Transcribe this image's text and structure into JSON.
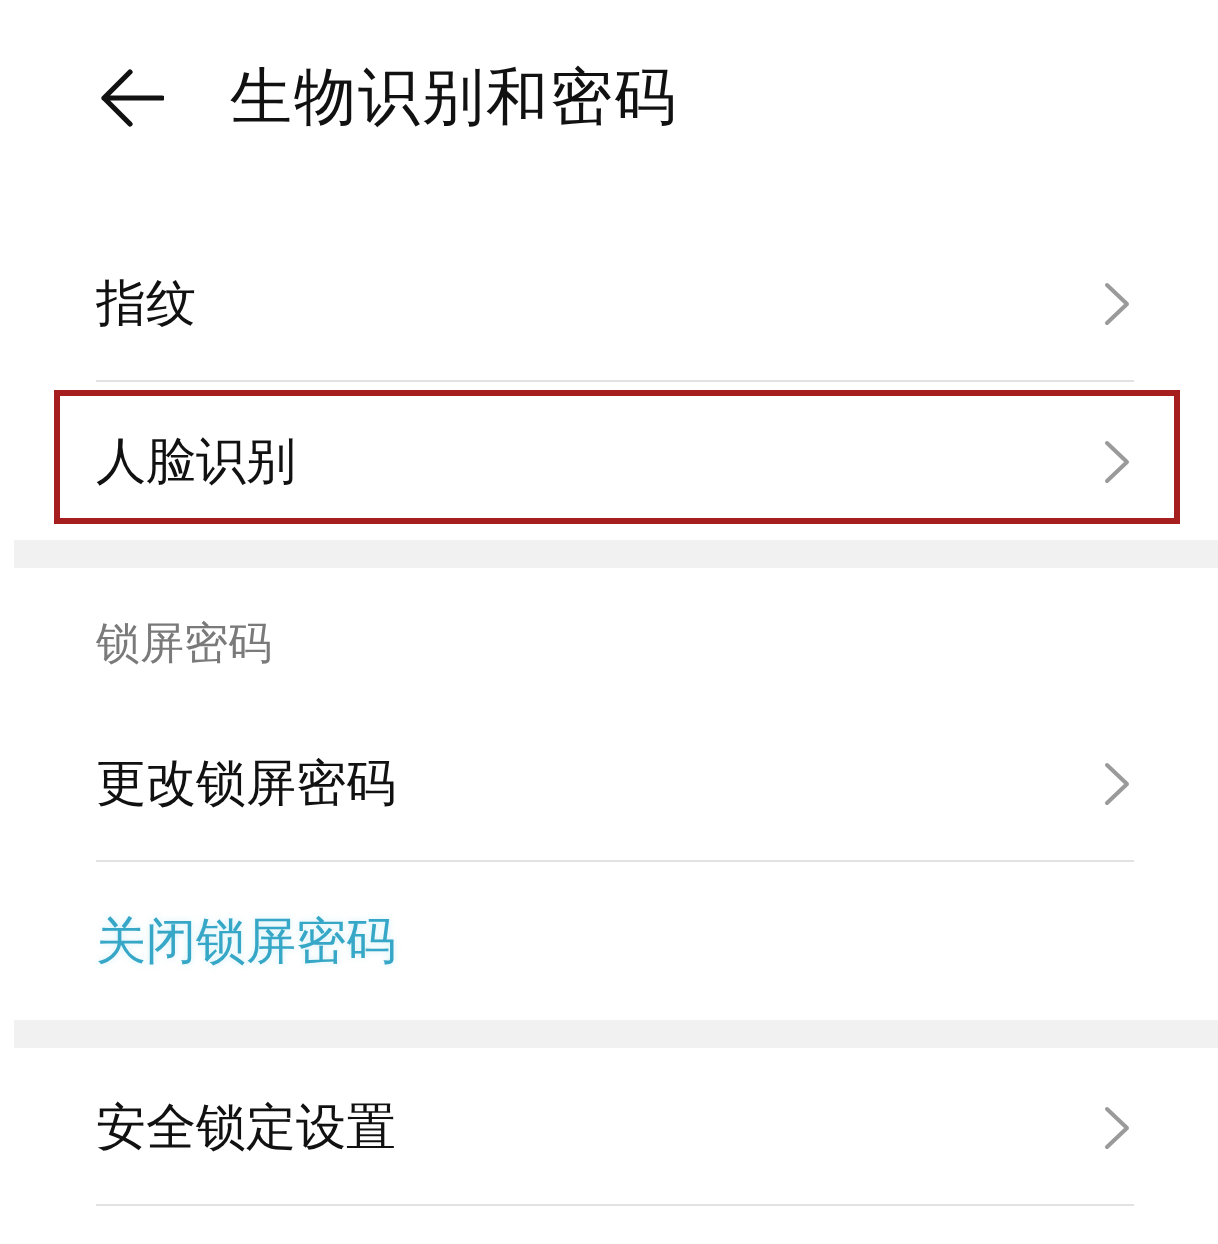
{
  "header": {
    "title": "生物识别和密码"
  },
  "sections": [
    {
      "rows": [
        {
          "kind": "link",
          "label": "指纹",
          "highlighted": false
        },
        {
          "kind": "link",
          "label": "人脸识别",
          "highlighted": true
        }
      ]
    },
    {
      "heading": "锁屏密码",
      "rows": [
        {
          "kind": "link",
          "label": "更改锁屏密码",
          "highlighted": false
        },
        {
          "kind": "action",
          "label": "关闭锁屏密码",
          "highlighted": false
        }
      ]
    },
    {
      "rows": [
        {
          "kind": "link",
          "label": "安全锁定设置",
          "highlighted": false
        }
      ]
    }
  ]
}
